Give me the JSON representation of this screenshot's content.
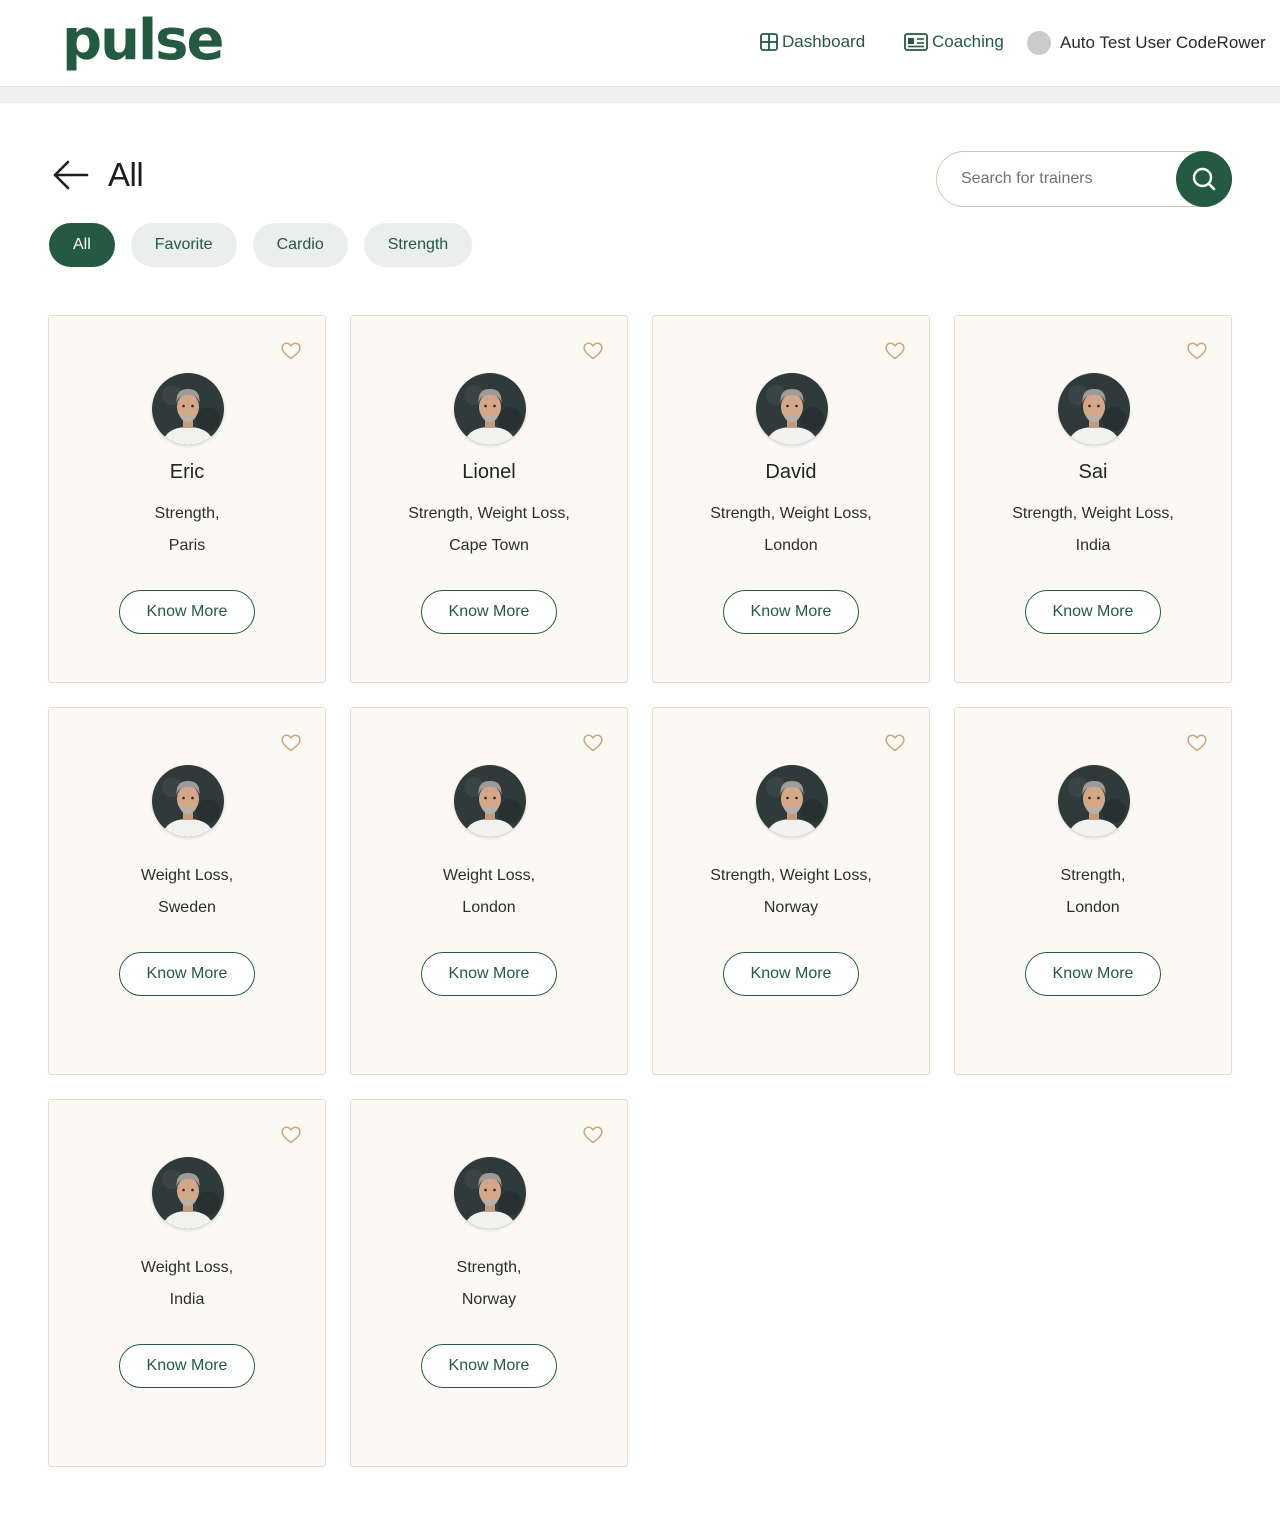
{
  "header": {
    "logo": "pulse",
    "nav": [
      {
        "label": "Dashboard",
        "icon": "grid-icon"
      },
      {
        "label": "Coaching",
        "icon": "id-card-icon"
      }
    ],
    "user_name": "Auto Test User CodeRower"
  },
  "page": {
    "title": "All",
    "search_placeholder": "Search for trainers"
  },
  "filters": [
    {
      "label": "All",
      "active": true
    },
    {
      "label": "Favorite",
      "active": false
    },
    {
      "label": "Cardio",
      "active": false
    },
    {
      "label": "Strength",
      "active": false
    }
  ],
  "trainers": [
    {
      "name": "Eric",
      "specialties": "Strength,",
      "location": "Paris",
      "button": "Know More"
    },
    {
      "name": "Lionel",
      "specialties": "Strength, Weight Loss,",
      "location": "Cape Town",
      "button": "Know More"
    },
    {
      "name": "David",
      "specialties": "Strength, Weight Loss,",
      "location": "London",
      "button": "Know More"
    },
    {
      "name": "Sai",
      "specialties": "Strength, Weight Loss,",
      "location": "India",
      "button": "Know More"
    },
    {
      "name": "",
      "specialties": "Weight Loss,",
      "location": "Sweden",
      "button": "Know More"
    },
    {
      "name": "",
      "specialties": "Weight Loss,",
      "location": "London",
      "button": "Know More"
    },
    {
      "name": "",
      "specialties": "Strength, Weight Loss,",
      "location": "Norway",
      "button": "Know More"
    },
    {
      "name": "",
      "specialties": "Strength,",
      "location": "London",
      "button": "Know More"
    },
    {
      "name": "",
      "specialties": "Weight Loss,",
      "location": "India",
      "button": "Know More"
    },
    {
      "name": "",
      "specialties": "Strength,",
      "location": "Norway",
      "button": "Know More"
    }
  ],
  "colors": {
    "brand": "#245a42",
    "card_bg": "#fcf9f5",
    "card_border": "#e6dccc",
    "heart": "#c9a77a"
  }
}
